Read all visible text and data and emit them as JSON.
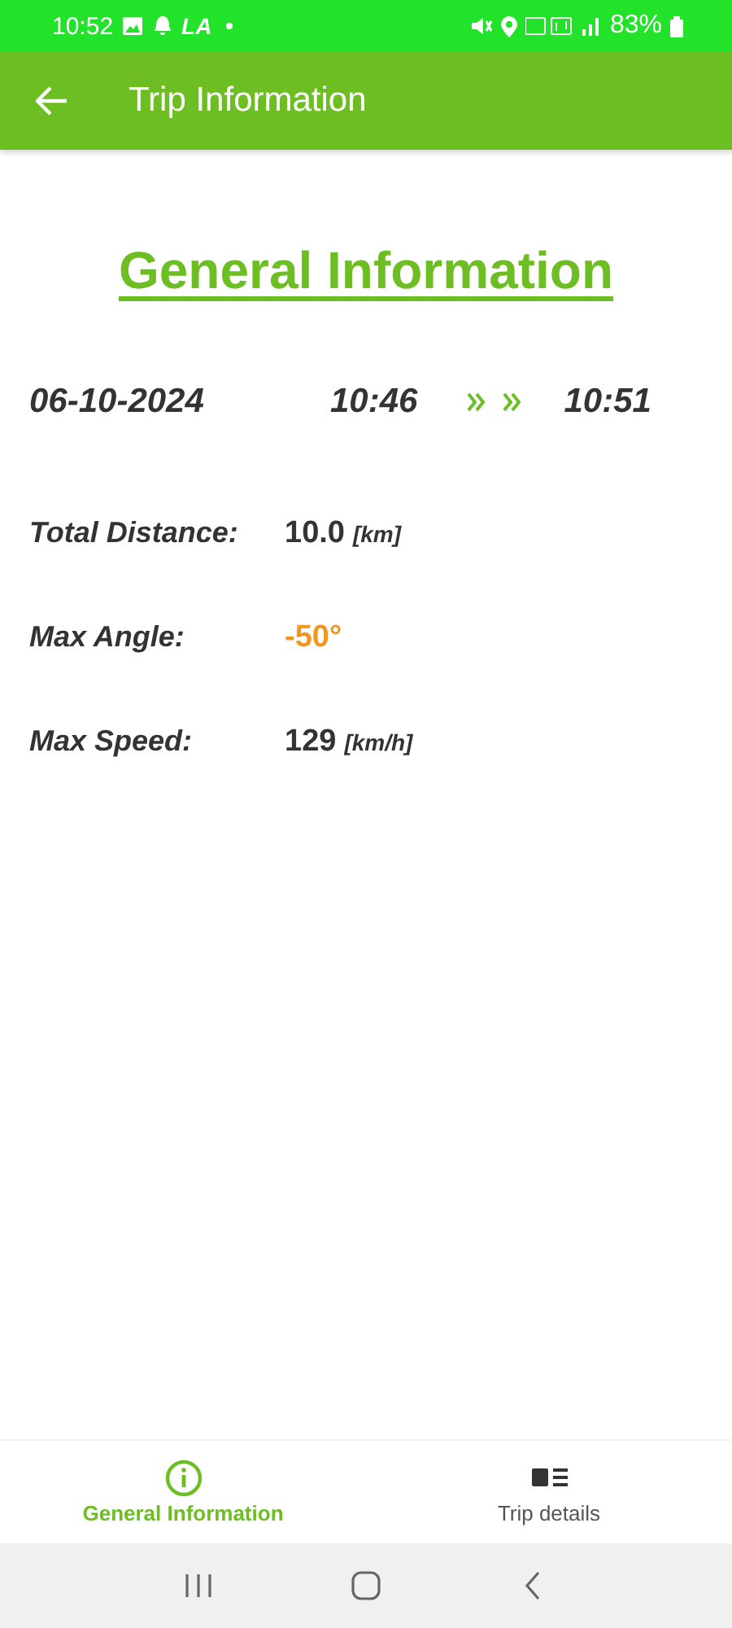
{
  "status_bar": {
    "time": "10:52",
    "app_badge": "LA",
    "battery": "83%"
  },
  "app_bar": {
    "title": "Trip Information"
  },
  "heading": "General Information",
  "trip": {
    "date": "06-10-2024",
    "start": "10:46",
    "end": "10:51"
  },
  "stats": [
    {
      "label": "Total Distance:",
      "value": "10.0",
      "unit": "[km]"
    },
    {
      "label": "Max Angle:",
      "value": "-50°",
      "color": "#f0961e"
    },
    {
      "label": "Max Speed:",
      "value": "129",
      "unit": "[km/h]"
    }
  ],
  "bottom_nav": [
    {
      "label": "General Information",
      "kind": "info",
      "selected": true
    },
    {
      "label": "Trip details",
      "kind": "details",
      "selected": false
    }
  ]
}
